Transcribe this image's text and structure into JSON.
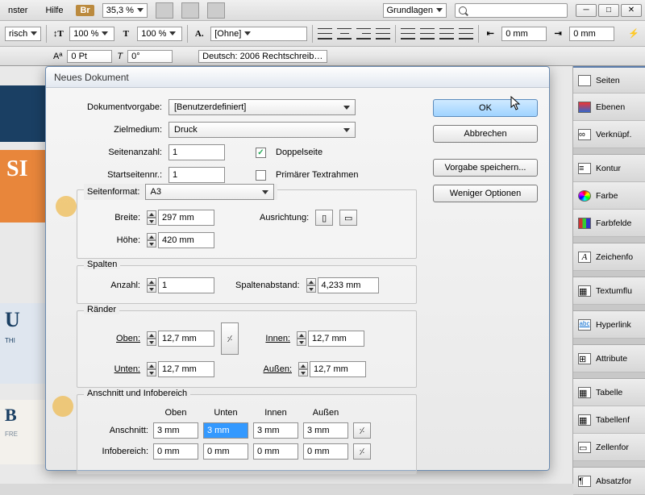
{
  "menubar": {
    "items": [
      "nster",
      "Hilfe"
    ],
    "br": "Br",
    "zoom": "35,3 %",
    "workspace": "Grundlagen"
  },
  "toolbar2": {
    "pct1": "100 %",
    "pct2": "100 %",
    "charstyle": "[Ohne]",
    "marginVal": "0 mm",
    "indentVal": "0 mm"
  },
  "toolbar3": {
    "pt": "0 Pt",
    "deg": "0°",
    "lang": "Deutsch: 2006 Rechtschreib…"
  },
  "docbg": {
    "orange": "SI",
    "u": "U",
    "sub": "THI",
    "b": "B",
    "bsub": "FRE"
  },
  "panels": [
    {
      "name": "Seiten"
    },
    {
      "name": "Ebenen"
    },
    {
      "name": "Verknüpf."
    },
    {
      "name": "Kontur"
    },
    {
      "name": "Farbe"
    },
    {
      "name": "Farbfelde"
    },
    {
      "name": "Zeichenfo"
    },
    {
      "name": "Textumflu"
    },
    {
      "name": "Hyperlink"
    },
    {
      "name": "Attribute"
    },
    {
      "name": "Tabelle"
    },
    {
      "name": "Tabellenf"
    },
    {
      "name": "Zellenfor"
    },
    {
      "name": "Absatzfor"
    }
  ],
  "dialog": {
    "title": "Neues Dokument",
    "labels": {
      "preset": "Dokumentvorgabe:",
      "intent": "Zielmedium:",
      "pages": "Seitenanzahl:",
      "start": "Startseitennr.:",
      "facing": "Doppelseite",
      "primary": "Primärer Textrahmen",
      "format": "Seitenformat:",
      "width": "Breite:",
      "height": "Höhe:",
      "orient": "Ausrichtung:",
      "columns": "Spalten",
      "number": "Anzahl:",
      "gutter": "Spaltenabstand:",
      "margins": "Ränder",
      "top": "Oben:",
      "bottom": "Unten:",
      "inside": "Innen:",
      "outside": "Außen:",
      "bleed_section": "Anschnitt und Infobereich",
      "bleed": "Anschnitt:",
      "slug": "Infobereich:"
    },
    "values": {
      "preset": "[Benutzerdefiniert]",
      "intent": "Druck",
      "pages": "1",
      "start": "1",
      "format": "A3",
      "width": "297 mm",
      "height": "420 mm",
      "number": "1",
      "gutter": "4,233 mm",
      "top": "12,7 mm",
      "bottom": "12,7 mm",
      "inside": "12,7 mm",
      "outside": "12,7 mm",
      "bleed_top": "3 mm",
      "bleed_bottom": "3 mm",
      "bleed_inside": "3 mm",
      "bleed_outside": "3 mm",
      "slug_top": "0 mm",
      "slug_bottom": "0 mm",
      "slug_inside": "0 mm",
      "slug_outside": "0 mm"
    },
    "headers": {
      "top": "Oben",
      "bottom": "Unten",
      "inside": "Innen",
      "outside": "Außen"
    },
    "buttons": {
      "ok": "OK",
      "cancel": "Abbrechen",
      "save": "Vorgabe speichern...",
      "less": "Weniger Optionen"
    }
  }
}
